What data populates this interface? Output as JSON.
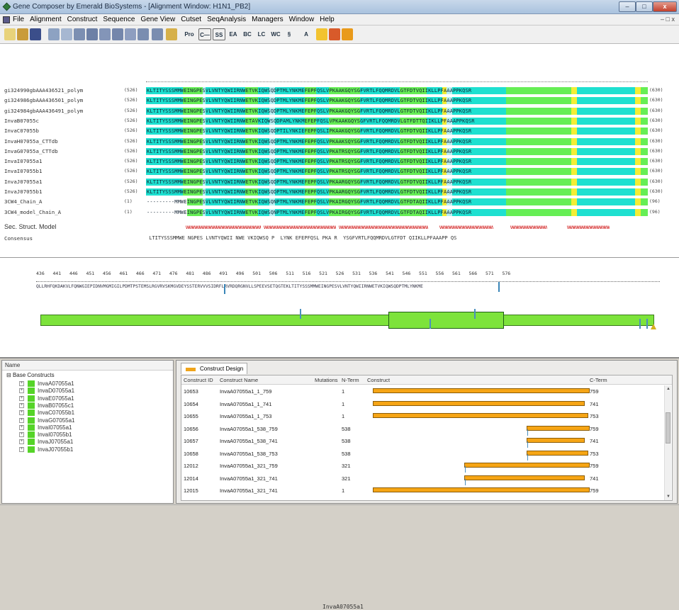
{
  "window": {
    "title": "Gene Composer by Emerald BioSystems - [Alignment Window: H1N1_PB2]",
    "min": "–",
    "max": "□",
    "close": "x",
    "mdi_controls": "– □ x"
  },
  "menu": [
    "File",
    "Alignment",
    "Construct",
    "Sequence",
    "Gene View",
    "Cutset",
    "SeqAnalysis",
    "Managers",
    "Window",
    "Help"
  ],
  "toolbar": {
    "buttons": [
      "open-icon",
      "save-icon",
      "floppy-icon",
      "align-icon",
      "align2-icon",
      "bar-icon",
      "bar2-icon",
      "tool1-icon",
      "tool2-icon",
      "tool3-icon",
      "tool4-icon",
      "tool5-icon",
      "tool6-icon",
      "Pro",
      "C—",
      "SS",
      "EA",
      "BC",
      "LC",
      "WC",
      "§",
      "A",
      "chart1-icon",
      "chart2-icon",
      "chart3-icon"
    ]
  },
  "alignment": {
    "rows": [
      {
        "name": "gi324990gbAAA436521_polym",
        "start": "(526)",
        "end": "(630)",
        "seq": "KLTITYSSSMMWEINGPESVLVNTYQWIIRNWETVKIQWSQDPTMLYNKMEFEPFQSLVPKAAKGQYSGFVRTLFQQMRDVLGTFDTVQIIKLLPFAAAPPKQSR"
      },
      {
        "name": "gi324986gbAAA436501_polym",
        "start": "(526)",
        "end": "(630)",
        "seq": "KLTITYSSSMMWEINGPESVLVNTYQWIIRNWETVKIQWSQDPTMLYNKMEFEPFQSLVPKAAKGQYSGFVRTLFQQMRDVLGTFDTVQIIKLLPFAAAPPKQSR"
      },
      {
        "name": "gi324984gbAAA436491_polym",
        "start": "(526)",
        "end": "(630)",
        "seq": "KLTITYSSSMMWEINGPESVLVNTYQWIIRNWETVKIQWSQDPTMLYNKMEFEPFQSLVPKAAKGQYSGFVRTLFQQMRDVLGTFDTVQIIKLLPFAAAPPKQSR"
      },
      {
        "name": "InvaB07055c",
        "start": "(526)",
        "end": "(630)",
        "seq": "KLTITYSSSMMWEINGPESVLVNTYQWIIRNWETAVKIQWSQDPAMLYNKMEFEPFQSLVPKAAKGQYSGFVRTLFQQMRDVLGTFDTTQIIKLLPFAAAPPKQSR"
      },
      {
        "name": "InvaC07055b",
        "start": "(526)",
        "end": "(630)",
        "seq": "KLTITYSSSMMWEINGPESVLVNTYQWIIRNWETVKIQWSQDPTILYNKIEFEPFQSLIPKAAKGQYSGFVRTLFQQMRDVLGTFDTVQIIKLLPFAAAPPKQSR"
      },
      {
        "name": "InvaH07055a_CTTdb",
        "start": "(526)",
        "end": "(630)",
        "seq": "KLTITYSSSMMWEINGPESVLVNTYQWIIRNWETVKIQWSQDPTMLYNKMEFEPFQSLVPKAAKSQYSGFVRTLFQQMRDVLGTFDTVQIIKLLPFAAAPPKQSR"
      },
      {
        "name": "InvaG07055a_CTTdb",
        "start": "(526)",
        "end": "(630)",
        "seq": "KLTITYSSSMMWEINGPESVLVNTYQWIIRNWETVKIQWSQDPTMLYNKMEFEPFQSLVPKATRSQYSGFVRTLFQQMRDVLGTFDTVQIIKLLPFAAAPPKQSR"
      },
      {
        "name": "InvaI07055a1",
        "start": "(526)",
        "end": "(630)",
        "seq": "KLTITYSSSMMWEINGPESVLVNTYQWIIRNWETVKIQWSQDPTMLYNKMEFEPFQSLVPKATRSQYSGFVRTLFQQMRDVLGTFDTVQIIKLLPFAAAPPKQSR"
      },
      {
        "name": "InvaI07055b1",
        "start": "(526)",
        "end": "(630)",
        "seq": "KLTITYSSSMMWEINGPESVLVNTYQWIIRNWETVKIQWSQDPTMLYNKMEFEPFQSLVPKATRSQYSGFVRTLFQQMRDVLGTFDTVQIIKLLPFAAAPPKQSR"
      },
      {
        "name": "InvaJ07055a1",
        "start": "(526)",
        "end": "(630)",
        "seq": "KLTITYSSSMMWEINGPESVLVNTYQWIIRNWETVKIQWSQDPTMLYNKMEFEPFQSLVPKAARGQYSGFVRTLFQQMRDVLGTFDTVQIIKLLPFAAAPPKQSR"
      },
      {
        "name": "InvaJ07055b1",
        "start": "(526)",
        "end": "(630)",
        "seq": "KLTITYSSSMMWEINGPESVLVNTYQWIIRNWETVKIQWSQDPTMLYNKMEFEPFQSLVPKAARGQYSGFVRTLFQQMRDVLGTFDTVQIIKLLPFAAAPPKQSR"
      },
      {
        "name": "3CW4_Chain_A",
        "start": "(1)",
        "end": "(96)",
        "seq": "---------MMWEINGPESVLVNTYQWIIRNWETVKIQWSQNPTMLYNKMEFEPFQSLVPKAIRGQYSGFVRTLFQQMRDVLGTFDTAQIIKLLPFAAAPPKQSR"
      },
      {
        "name": "3CW4_model_Chain_A",
        "start": "(1)",
        "end": "(96)",
        "seq": "---------MMWEINGPESVLVNTYQWIIRNWETVKIQWSQNPTMLYNKMEFEPFQSLVPKAIRGQYSGFVRTLFQQMRDVLGTFDTAQIIKLLPFAAAPPKQSR"
      }
    ],
    "secstruct_label": "Sec. Struct. Model",
    "consensus_label": "Consensus",
    "consensus": " LTITYSSSMMWE NGPES LVNTYQWII NWE VKIQWSQ P  LYNK EFEPFQSL PKA R  YSGFVRTLFQQMRDVLGTFDT QIIKLLPFAAAPP QS "
  },
  "map": {
    "ticks": "436   441   446   451   456   461   466   471   476   481   486   491   496   501   506   511   516   521   526   531   536   541   546   551   556   561   566   571   576",
    "sequence": "QLLRHFQKDAKVLFQNWGIEPIDNVMGMIGILPDMTPSTEMSLRGVRVSKMGVDEYSSTERVVVSIDRFLRVRDQRGNVLLSPEEVSETQGTEKLTITYSSSMMWEINGPESVLVNTYQWIIRNWETVKIQWSQDPTMLYNKME",
    "construct_name": "InvaA07055a1"
  },
  "tree": {
    "header": "Name",
    "root": "Base Constructs",
    "items": [
      "InvaA07055a1",
      "InvaD07055a1",
      "InvaE07055a1",
      "InvaB07055c1",
      "InvaC07055b1",
      "InvaG07055a1",
      "InvaI07055a1",
      "InvaI07055b1",
      "InvaJ07055a1",
      "InvaJ07055b1"
    ]
  },
  "design": {
    "tab": "Construct Design",
    "headers": {
      "id": "Construct ID",
      "name": "Construct Name",
      "mut": "Mutations",
      "nterm": "N-Term",
      "construct": "Construct",
      "cterm": "C-Term"
    },
    "rows": [
      {
        "id": "10653",
        "name": "InvaA07055a1_1_759",
        "nterm": "1",
        "cterm": "759",
        "bar_start": 0.0,
        "bar_end": 1.0
      },
      {
        "id": "10654",
        "name": "InvaA07055a1_1_741",
        "nterm": "1",
        "cterm": "741",
        "bar_start": 0.0,
        "bar_end": 0.976
      },
      {
        "id": "10655",
        "name": "InvaA07055a1_1_753",
        "nterm": "1",
        "cterm": "753",
        "bar_start": 0.0,
        "bar_end": 0.992
      },
      {
        "id": "10656",
        "name": "InvaA07055a1_538_759",
        "nterm": "538",
        "cterm": "759",
        "bar_start": 0.709,
        "bar_end": 1.0
      },
      {
        "id": "10657",
        "name": "InvaA07055a1_538_741",
        "nterm": "538",
        "cterm": "741",
        "bar_start": 0.709,
        "bar_end": 0.976
      },
      {
        "id": "10658",
        "name": "InvaA07055a1_538_753",
        "nterm": "538",
        "cterm": "753",
        "bar_start": 0.709,
        "bar_end": 0.992
      },
      {
        "id": "12012",
        "name": "InvaA07055a1_321_759",
        "nterm": "321",
        "cterm": "759",
        "bar_start": 0.422,
        "bar_end": 1.0
      },
      {
        "id": "12014",
        "name": "InvaA07055a1_321_741",
        "nterm": "321",
        "cterm": "741",
        "bar_start": 0.422,
        "bar_end": 0.976
      },
      {
        "id": "12015",
        "name": "InvaA07055a1_321_741",
        "nterm": "1",
        "cterm": "759",
        "bar_start": 0.0,
        "bar_end": 1.0
      }
    ]
  },
  "colors": {
    "identity": "#1ee0d0",
    "similar": "#66ee55",
    "partial": "#b6f0f2",
    "variant": "#f2ee35",
    "bar": "#f6a515",
    "green": "#7de33b"
  }
}
